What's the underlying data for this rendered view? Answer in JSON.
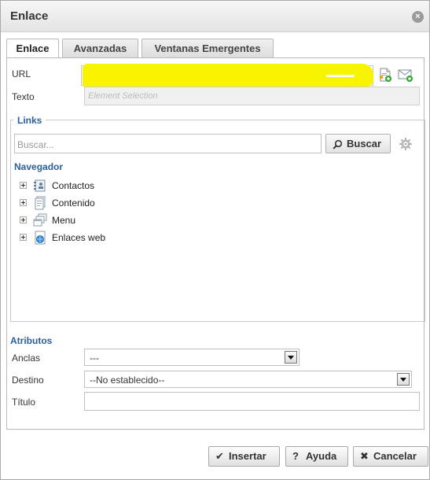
{
  "dialog": {
    "title": "Enlace",
    "close_icon": "close-icon"
  },
  "tabs": [
    {
      "label": "Enlace",
      "active": true
    },
    {
      "label": "Avanzadas",
      "active": false
    },
    {
      "label": "Ventanas Emergentes",
      "active": false
    }
  ],
  "form": {
    "url_label": "URL",
    "url_value": "",
    "url_icons": [
      "add-file-icon",
      "add-email-icon"
    ],
    "texto_label": "Texto",
    "texto_placeholder": "Element Selection"
  },
  "links": {
    "legend": "Links",
    "search_placeholder": "Buscar...",
    "search_button": "Buscar",
    "navigator_title": "Navegador",
    "tree": [
      {
        "label": "Contactos",
        "icon": "contacts-icon"
      },
      {
        "label": "Contenido",
        "icon": "content-icon"
      },
      {
        "label": "Menu",
        "icon": "menu-icon"
      },
      {
        "label": "Enlaces web",
        "icon": "weblinks-icon"
      }
    ]
  },
  "atributos": {
    "title": "Atributos",
    "anclas_label": "Anclas",
    "anclas_value": "---",
    "destino_label": "Destino",
    "destino_value": "--No establecido--",
    "titulo_label": "Título",
    "titulo_value": ""
  },
  "buttons": {
    "insert": "Insertar",
    "help": "Ayuda",
    "cancel": "Cancelar"
  },
  "colors": {
    "accent": "#2b5f9e",
    "highlight": "#f8f400"
  }
}
